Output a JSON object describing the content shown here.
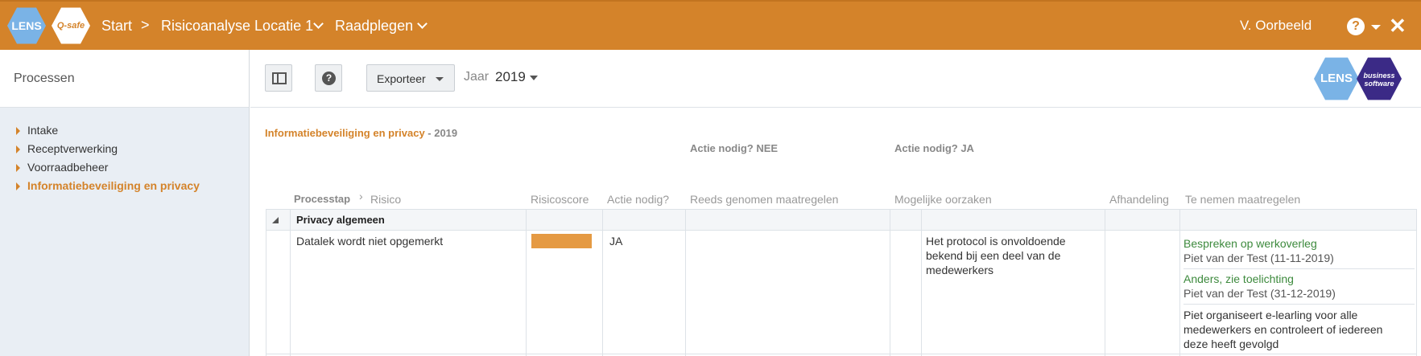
{
  "header": {
    "logo_lens": "LENS",
    "logo_qsafe": "Q-safe",
    "breadcrumb": [
      "Start",
      "Risicoanalyse Locatie 1",
      "Raadplegen"
    ],
    "separator": ">",
    "user": "V. Oorbeeld",
    "help": "?",
    "close": "✕"
  },
  "sidebar": {
    "title": "Processen",
    "items": [
      {
        "label": "Intake",
        "active": false
      },
      {
        "label": "Receptverwerking",
        "active": false
      },
      {
        "label": "Voorraadbeheer",
        "active": false
      },
      {
        "label": "Informatiebeveiliging en privacy",
        "active": true
      }
    ]
  },
  "toolbar": {
    "help_glyph": "?",
    "export_label": "Exporteer",
    "year_label": "Jaar",
    "year_value": "2019",
    "logo_lens": "LENS",
    "logo_business_line1": "business",
    "logo_business_line2": "software"
  },
  "content": {
    "title": "Informatiebeveiliging en privacy",
    "title_year": " - 2019",
    "group_nee": "Actie nodig? NEE",
    "group_ja": "Actie nodig? JA",
    "columns": {
      "processtap": "Processtap",
      "sep": "›",
      "risico": "Risico",
      "risicoscore": "Risicoscore",
      "actie_nodig": "Actie nodig?",
      "reeds": "Reeds genomen maatregelen",
      "oorzaken": "Mogelijke oorzaken",
      "afhandeling": "Afhandeling",
      "te_nemen": "Te nemen maatregelen"
    },
    "category": "Privacy algemeen",
    "row": {
      "risico": "Datalek wordt niet opgemerkt",
      "actie_nodig": "JA",
      "oorzaak_line1": "Het protocol is onvoldoende",
      "oorzaak_line2": "bekend bij een deel van de",
      "oorzaak_line3": "medewerkers",
      "maatregelen": [
        {
          "title": "Bespreken op werkoverleg",
          "who": "Piet van der Test (11-11-2019)"
        },
        {
          "title": "Anders, zie toelichting",
          "who": "Piet van der Test (31-12-2019)"
        }
      ],
      "toelichting_line1": "Piet organiseert e-learling voor alle",
      "toelichting_line2": "medewerkers en controleert of iedereen",
      "toelichting_line3": "deze heeft gevolgd"
    }
  },
  "colors": {
    "brand_orange": "#d4832a",
    "risk_bar": "#e59a43",
    "link_green": "#3d8a3d",
    "lens_blue": "#7ab3e6",
    "business_purple": "#3b2a86"
  }
}
